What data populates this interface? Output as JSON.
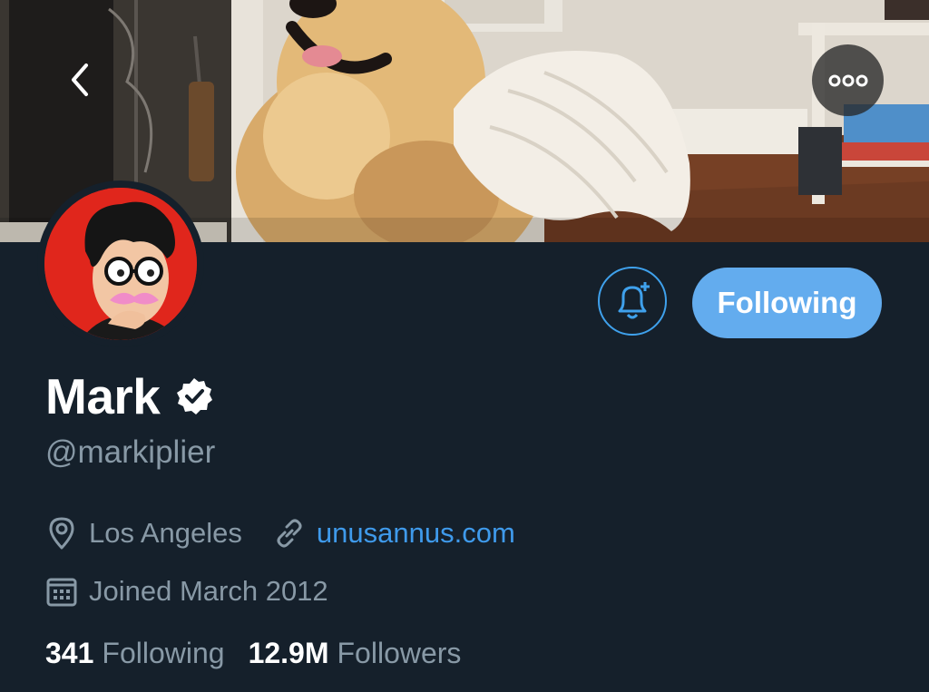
{
  "profile": {
    "display_name": "Mark",
    "handle": "@markiplier",
    "location": "Los Angeles",
    "website": "unusannus.com",
    "joined": "Joined March 2012"
  },
  "actions": {
    "follow_state_label": "Following"
  },
  "stats": {
    "following_count": "341",
    "following_label": "Following",
    "followers_count": "12.9M",
    "followers_label": "Followers"
  },
  "icons": {
    "back": "chevron-left-icon",
    "more": "more-dots-icon",
    "notify": "bell-plus-icon",
    "verified": "verified-badge-icon",
    "location": "map-pin-icon",
    "link": "link-icon",
    "calendar": "calendar-icon"
  },
  "colors": {
    "background": "#15202b",
    "accent": "#63acee",
    "link": "#3f9aeb",
    "muted_text": "#8899a6",
    "primary_text": "#ffffff"
  }
}
